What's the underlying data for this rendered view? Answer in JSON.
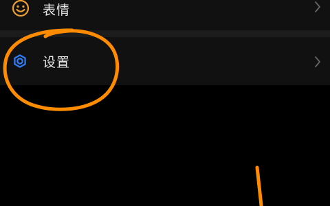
{
  "menu": {
    "items": [
      {
        "icon": "smiley-icon",
        "label": "表情",
        "chevron": "chevron-right-icon"
      },
      {
        "icon": "gear-icon",
        "label": "设置",
        "chevron": "chevron-right-icon"
      }
    ]
  },
  "colors": {
    "background": "#000000",
    "row_background": "#111111",
    "divider": "#1c1c1c",
    "label_text": "#e6e6e6",
    "emoji_icon": "#f0a030",
    "settings_icon": "#2f7cf6",
    "chevron": "#666666",
    "annotation": "#ff8c00"
  }
}
